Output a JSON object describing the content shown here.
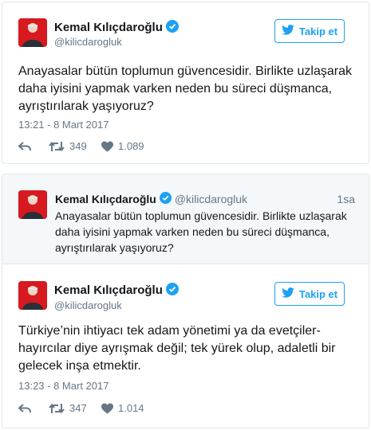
{
  "tweet1": {
    "name": "Kemal Kılıçdaroğlu",
    "handle": "@kilicdarogluk",
    "follow_label": "Takip et",
    "text": "Anayasalar bütün toplumun güvencesidir. Birlikte uzlaşarak daha iyisini yapmak varken neden bu süreci düşmanca, ayrıştırılarak yaşıyoruz?",
    "timestamp": "13:21 - 8 Mart 2017",
    "retweets": "349",
    "likes": "1.089"
  },
  "quoted": {
    "name": "Kemal Kılıçdaroğlu",
    "handle": "@kilicdarogluk",
    "time": "1sa",
    "text": "Anayasalar bütün toplumun güvencesidir. Birlikte uzlaşarak daha iyisini yapmak varken neden bu süreci düşmanca, ayrıştırılarak yaşıyoruz?"
  },
  "tweet2": {
    "name": "Kemal Kılıçdaroğlu",
    "handle": "@kilicdarogluk",
    "follow_label": "Takip et",
    "text": "Türkiye’nin ihtiyacı tek adam yönetimi ya da evetçiler-hayırcılar diye ayrışmak değil; tek yürek olup, adaletli bir gelecek inşa etmektir.",
    "timestamp": "13:23 - 8 Mart 2017",
    "retweets": "347",
    "likes": "1.014"
  },
  "colors": {
    "accent": "#1da1f2",
    "muted": "#657786",
    "text": "#14171a",
    "quoted_bg": "#f5f8fa"
  },
  "icons": [
    "verified-badge-icon",
    "twitter-bird-icon",
    "reply-icon",
    "retweet-icon",
    "heart-icon"
  ]
}
